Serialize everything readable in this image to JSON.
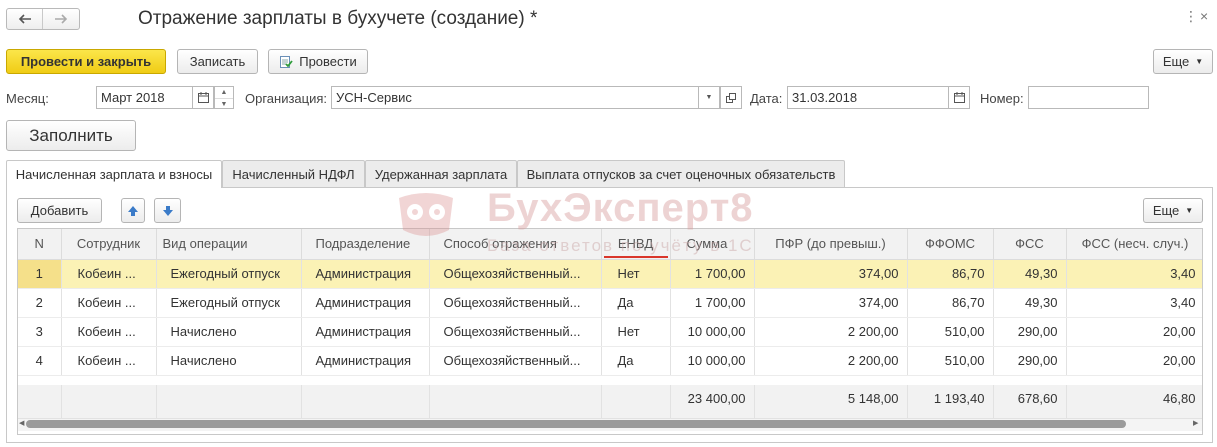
{
  "window": {
    "title": "Отражение зарплаты в бухучете (создание) *"
  },
  "nav": {
    "back_icon": "arrow-left-icon",
    "forward_icon": "arrow-right-icon"
  },
  "toolbar": {
    "post_close": "Провести и закрыть",
    "save": "Записать",
    "post": "Провести",
    "more": "Еще"
  },
  "form": {
    "month_label": "Месяц:",
    "month_value": "Март 2018",
    "org_label": "Организация:",
    "org_value": "УСН-Сервис",
    "date_label": "Дата:",
    "date_value": "31.03.2018",
    "number_label": "Номер:",
    "number_value": "",
    "fill_button": "Заполнить"
  },
  "tabs": [
    {
      "label": "Начисленная зарплата и взносы",
      "active": true
    },
    {
      "label": "Начисленный НДФЛ",
      "active": false
    },
    {
      "label": "Удержанная зарплата",
      "active": false
    },
    {
      "label": "Выплата отпусков за счет оценочных обязательств",
      "active": false
    }
  ],
  "table_toolbar": {
    "add": "Добавить",
    "more": "Еще"
  },
  "watermark": {
    "brand": "БухЭксперт8",
    "tagline": "База ответов по учёту в 1С"
  },
  "table": {
    "columns": [
      "N",
      "Сотрудник",
      "Вид операции",
      "Подразделение",
      "Способ отражения",
      "ЕНВД",
      "Сумма",
      "ПФР (до превыш.)",
      "ФФОМС",
      "ФСС",
      "ФСС (несч. случ.)"
    ],
    "rows": [
      [
        "1",
        "Кобеин ...",
        "Ежегодный отпуск",
        "Администрация",
        "Общехозяйственный...",
        "Нет",
        "1 700,00",
        "374,00",
        "86,70",
        "49,30",
        "3,40"
      ],
      [
        "2",
        "Кобеин ...",
        "Ежегодный отпуск",
        "Администрация",
        "Общехозяйственный...",
        "Да",
        "1 700,00",
        "374,00",
        "86,70",
        "49,30",
        "3,40"
      ],
      [
        "3",
        "Кобеин ...",
        "Начислено",
        "Администрация",
        "Общехозяйственный...",
        "Нет",
        "10 000,00",
        "2 200,00",
        "510,00",
        "290,00",
        "20,00"
      ],
      [
        "4",
        "Кобеин ...",
        "Начислено",
        "Администрация",
        "Общехозяйственный...",
        "Да",
        "10 000,00",
        "2 200,00",
        "510,00",
        "290,00",
        "20,00"
      ]
    ],
    "totals": [
      "",
      "",
      "",
      "",
      "",
      "",
      "23 400,00",
      "5 148,00",
      "1 193,40",
      "678,60",
      "46,80"
    ],
    "selected_row": 0
  },
  "colors": {
    "primary_button": "#f0cc15",
    "selected_row": "#fbf2b5",
    "envd_underline": "#d9362b",
    "watermark": "#e8c6c6"
  }
}
